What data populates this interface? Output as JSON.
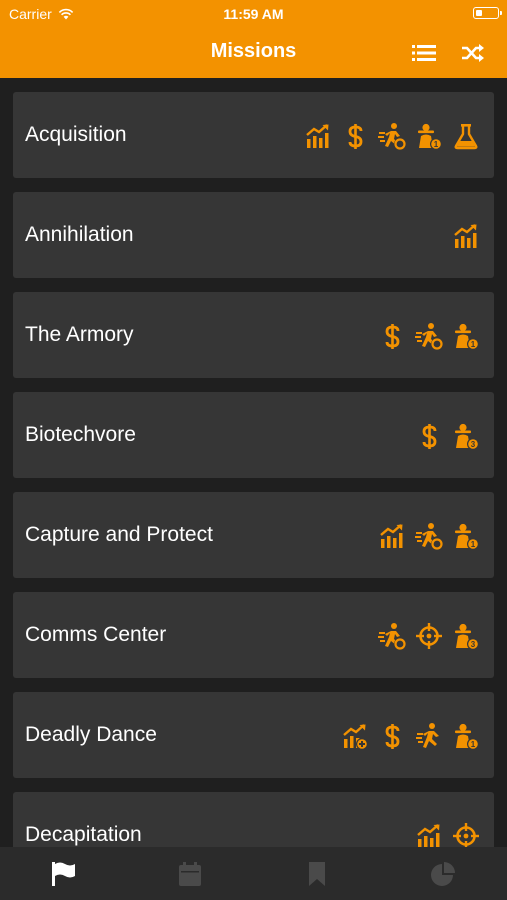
{
  "status_bar": {
    "carrier": "Carrier",
    "time": "11:59 AM",
    "battery_level": 0.3
  },
  "nav": {
    "title": "Missions",
    "list_icon": "list-icon",
    "shuffle_icon": "shuffle-icon"
  },
  "colors": {
    "accent": "#f39200",
    "background": "#1f1f1f",
    "row": "#363636",
    "tab_active": "#ffffff",
    "tab_inactive": "#4a4a4a"
  },
  "missions": [
    {
      "name": "Acquisition",
      "icons": [
        "chart-growth-icon",
        "dollar-icon",
        "runner-objective-icon",
        "spy-1-icon",
        "flask-icon"
      ]
    },
    {
      "name": "Annihilation",
      "icons": [
        "chart-growth-icon"
      ]
    },
    {
      "name": "The Armory",
      "icons": [
        "dollar-icon",
        "runner-objective-icon",
        "spy-1-icon"
      ]
    },
    {
      "name": "Biotechvore",
      "icons": [
        "dollar-icon",
        "spy-3-icon"
      ]
    },
    {
      "name": "Capture and Protect",
      "icons": [
        "chart-growth-icon",
        "runner-objective-icon",
        "spy-1-icon"
      ]
    },
    {
      "name": "Comms Center",
      "icons": [
        "runner-objective-icon",
        "crosshair-icon",
        "spy-3-icon"
      ]
    },
    {
      "name": "Deadly Dance",
      "icons": [
        "chart-growth-plus-icon",
        "dollar-icon",
        "runner-icon",
        "spy-1-icon"
      ]
    },
    {
      "name": "Decapitation",
      "icons": [
        "chart-growth-icon",
        "crosshair-icon"
      ]
    }
  ],
  "tabs": [
    {
      "name": "missions",
      "icon": "flag-icon",
      "active": true
    },
    {
      "name": "calendar",
      "icon": "calendar-icon",
      "active": false
    },
    {
      "name": "bookmarks",
      "icon": "bookmark-icon",
      "active": false
    },
    {
      "name": "stats",
      "icon": "pie-chart-icon",
      "active": false
    }
  ]
}
